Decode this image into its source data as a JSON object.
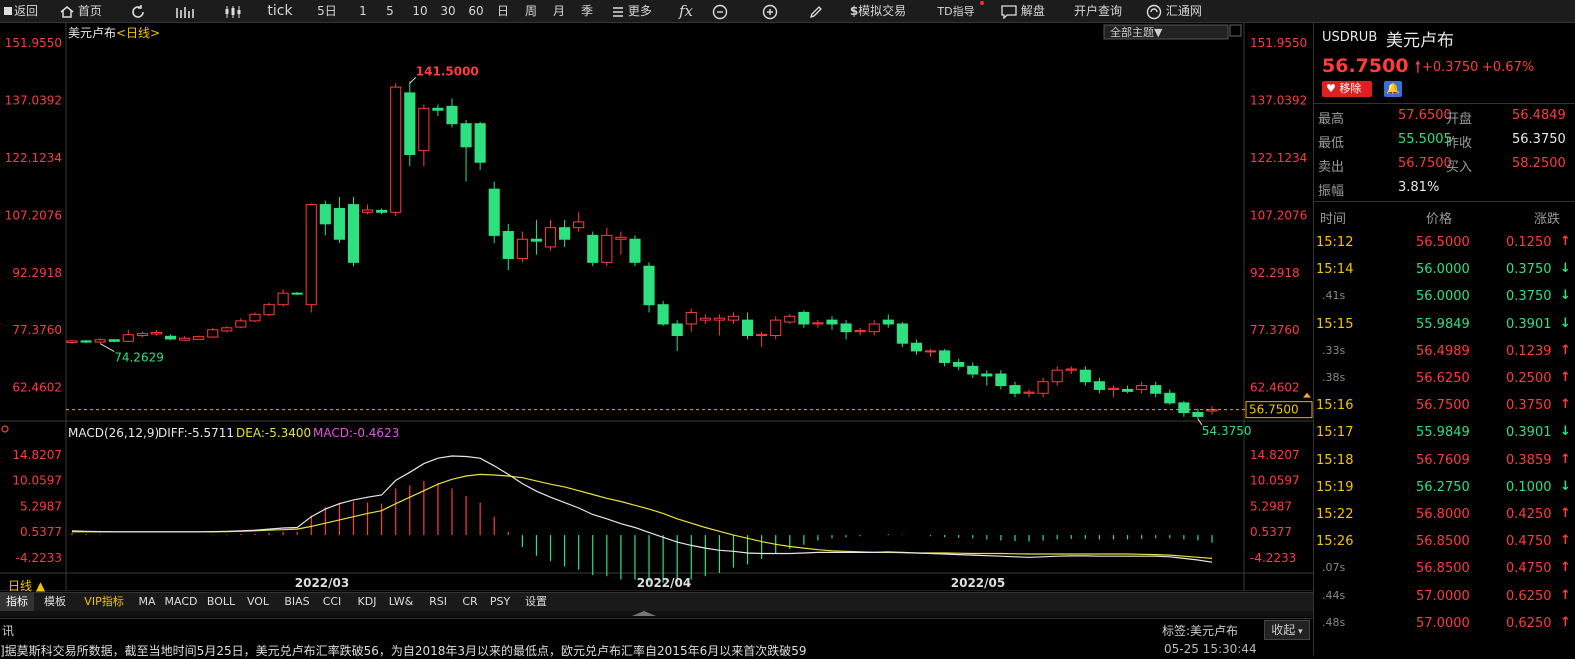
{
  "toolbar": {
    "back": "返回",
    "home": "首页",
    "tick": "tick",
    "periods": [
      "5日",
      "1",
      "5",
      "10",
      "30",
      "60",
      "日",
      "周",
      "月",
      "季"
    ],
    "more": "更多",
    "fx": "fx",
    "sim_trade": "模拟交易",
    "td_guide": "TD指导",
    "interpret": "解盘",
    "account_query": "开户查询",
    "htw": "汇通网"
  },
  "chart_header": {
    "name": "美元卢布",
    "period": "<日线>",
    "theme_button": "全部主题▼"
  },
  "chart_data": {
    "type": "candlestick",
    "price_axis_labels": [
      "151.9550",
      "137.0392",
      "122.1234",
      "107.2076",
      "92.2918",
      "77.3760",
      "62.4602"
    ],
    "price_range": [
      56.4,
      151.955
    ],
    "current_price_label": "56.7500",
    "max_label": "141.5000",
    "min_label": "54.3750",
    "start_label": "74.2629",
    "date_labels": [
      "2022/03",
      "2022/04",
      "2022/05"
    ],
    "candles": [
      [
        74.2,
        74.6,
        73.9,
        74.8
      ],
      [
        74.6,
        74.3,
        74.0,
        74.9
      ],
      [
        74.3,
        74.9,
        74.1,
        75.3
      ],
      [
        74.9,
        74.5,
        74.2,
        75.0
      ],
      [
        74.5,
        76.2,
        74.3,
        77.5
      ],
      [
        76.0,
        76.5,
        75.6,
        77.0
      ],
      [
        76.4,
        76.8,
        76.0,
        77.4
      ],
      [
        75.8,
        75.1,
        74.8,
        76.3
      ],
      [
        74.8,
        75.3,
        74.6,
        75.8
      ],
      [
        75.0,
        75.7,
        74.9,
        76.0
      ],
      [
        75.6,
        77.5,
        75.4,
        78.0
      ],
      [
        77.2,
        78.0,
        76.8,
        78.4
      ],
      [
        78.2,
        79.8,
        77.9,
        80.5
      ],
      [
        79.8,
        81.5,
        79.5,
        82.0
      ],
      [
        81.4,
        84.0,
        81.0,
        84.5
      ],
      [
        84.0,
        87.0,
        83.5,
        88.0
      ],
      [
        87.0,
        86.9,
        86.5,
        87.3
      ],
      [
        84.0,
        110.0,
        82.0,
        110.3
      ],
      [
        110.0,
        105.0,
        102.0,
        111.0
      ],
      [
        109.0,
        101.0,
        100.0,
        112.0
      ],
      [
        110.0,
        95.0,
        94.0,
        112.0
      ],
      [
        108.0,
        108.6,
        107.5,
        110.0
      ],
      [
        108.5,
        108.0,
        107.5,
        109.0
      ],
      [
        108.0,
        140.5,
        107.0,
        141.5
      ],
      [
        139.0,
        123.0,
        120.0,
        142.0
      ],
      [
        124.0,
        135.0,
        120.0,
        136.0
      ],
      [
        135.0,
        134.5,
        133.0,
        136.0
      ],
      [
        135.5,
        131.0,
        130.0,
        137.5
      ],
      [
        131.0,
        125.0,
        116.0,
        132.0
      ],
      [
        131.0,
        121.0,
        119.0,
        131.5
      ],
      [
        114.0,
        102.0,
        100.0,
        116.0
      ],
      [
        103.0,
        96.0,
        93.0,
        105.0
      ],
      [
        96.0,
        101.0,
        95.0,
        103.0
      ],
      [
        101.0,
        100.5,
        97.0,
        106.0
      ],
      [
        99.0,
        104.0,
        98.0,
        106.0
      ],
      [
        104.0,
        101.0,
        99.0,
        106.0
      ],
      [
        104.0,
        105.5,
        103.0,
        108.0
      ],
      [
        102.0,
        95.0,
        94.0,
        103.0
      ],
      [
        95.0,
        102.0,
        94.0,
        104.0
      ],
      [
        101.0,
        101.5,
        97.0,
        103.0
      ],
      [
        101.0,
        95.0,
        94.0,
        102.0
      ],
      [
        94.0,
        84.0,
        82.0,
        95.0
      ],
      [
        84.0,
        79.0,
        78.5,
        85.0
      ],
      [
        79.0,
        76.0,
        72.0,
        80.0
      ],
      [
        79.0,
        82.0,
        77.0,
        83.0
      ],
      [
        80.0,
        80.5,
        79.0,
        81.5
      ],
      [
        80.0,
        80.5,
        76.0,
        81.5
      ],
      [
        80.0,
        81.0,
        79.0,
        82.0
      ],
      [
        80.0,
        76.0,
        75.0,
        82.0
      ],
      [
        76.0,
        76.3,
        73.0,
        77.0
      ],
      [
        76.0,
        80.0,
        75.0,
        81.0
      ],
      [
        79.5,
        81.0,
        79.0,
        81.5
      ],
      [
        82.0,
        79.0,
        78.0,
        82.5
      ],
      [
        79.0,
        79.3,
        78.0,
        80.0
      ],
      [
        80.0,
        79.0,
        77.5,
        81.0
      ],
      [
        79.0,
        77.0,
        75.0,
        80.0
      ],
      [
        77.0,
        77.3,
        76.0,
        78.0
      ],
      [
        77.0,
        79.0,
        76.0,
        80.0
      ],
      [
        80.0,
        79.0,
        78.0,
        81.5
      ],
      [
        79.0,
        74.0,
        73.0,
        79.5
      ],
      [
        74.0,
        72.0,
        71.0,
        75.0
      ],
      [
        72.0,
        72.0,
        70.5,
        72.5
      ],
      [
        72.0,
        69.0,
        68.0,
        72.5
      ],
      [
        69.0,
        68.0,
        67.0,
        70.0
      ],
      [
        68.0,
        66.0,
        65.0,
        69.0
      ],
      [
        66.0,
        65.5,
        63.0,
        67.0
      ],
      [
        66.0,
        63.0,
        62.0,
        67.0
      ],
      [
        63.0,
        61.0,
        60.0,
        64.0
      ],
      [
        61.0,
        61.3,
        60.0,
        62.0
      ],
      [
        61.0,
        64.0,
        60.0,
        65.0
      ],
      [
        64.0,
        67.0,
        63.0,
        68.0
      ],
      [
        67.0,
        67.3,
        66.0,
        68.0
      ],
      [
        67.0,
        64.0,
        63.0,
        68.0
      ],
      [
        64.0,
        62.0,
        61.0,
        65.0
      ],
      [
        62.0,
        62.3,
        60.0,
        63.0
      ],
      [
        62.0,
        61.5,
        61.0,
        63.0
      ],
      [
        62.0,
        63.0,
        61.0,
        64.0
      ],
      [
        63.0,
        61.0,
        60.0,
        64.0
      ],
      [
        61.0,
        58.5,
        58.0,
        62.0
      ],
      [
        58.5,
        56.0,
        54.9,
        59.0
      ],
      [
        56.0,
        55.0,
        54.4,
        57.0
      ],
      [
        56.4,
        56.75,
        55.5,
        57.65
      ]
    ],
    "macd": {
      "label": "MACD(26,12,9)",
      "diff_label": "DIFF:-5.5711",
      "dea_label": "DEA:-5.3400",
      "macd_label": "MACD:-0.4623",
      "axis_labels": [
        "14.8207",
        "10.0597",
        "5.2987",
        "0.5377",
        "-4.2233"
      ],
      "range": [
        -7.0,
        17.0
      ],
      "diff": [
        0.8,
        0.7,
        0.65,
        0.6,
        0.6,
        0.6,
        0.6,
        0.6,
        0.6,
        0.6,
        0.65,
        0.7,
        0.8,
        0.9,
        1.1,
        1.3,
        1.4,
        3.4,
        4.8,
        5.8,
        6.5,
        7.0,
        7.4,
        10.1,
        11.6,
        13.2,
        14.2,
        14.6,
        14.5,
        14.2,
        12.8,
        11.2,
        9.5,
        8.1,
        7.0,
        6.0,
        5.0,
        3.8,
        3.0,
        2.1,
        1.4,
        0.5,
        -0.4,
        -1.3,
        -1.9,
        -2.4,
        -2.8,
        -3.0,
        -3.3,
        -3.4,
        -3.4,
        -3.4,
        -3.3,
        -3.2,
        -3.2,
        -3.2,
        -3.2,
        -3.2,
        -3.1,
        -3.2,
        -3.3,
        -3.4,
        -3.5,
        -3.6,
        -3.7,
        -3.8,
        -3.9,
        -4.0,
        -4.1,
        -4.0,
        -3.9,
        -3.85,
        -3.85,
        -3.9,
        -3.9,
        -3.9,
        -3.9,
        -3.9,
        -4.0,
        -4.3,
        -4.6,
        -5.0
      ],
      "dea": [
        0.6,
        0.6,
        0.6,
        0.6,
        0.6,
        0.6,
        0.6,
        0.6,
        0.6,
        0.6,
        0.6,
        0.65,
        0.7,
        0.8,
        0.9,
        1.0,
        1.1,
        1.6,
        2.2,
        2.8,
        3.4,
        4.0,
        4.5,
        5.8,
        7.0,
        8.2,
        9.4,
        10.3,
        10.9,
        11.2,
        11.1,
        10.9,
        10.6,
        10.0,
        9.4,
        8.9,
        8.2,
        7.5,
        6.8,
        6.2,
        5.5,
        4.8,
        4.0,
        3.0,
        2.2,
        1.4,
        0.7,
        0.0,
        -0.6,
        -1.2,
        -1.7,
        -2.1,
        -2.4,
        -2.7,
        -2.9,
        -3.0,
        -3.1,
        -3.2,
        -3.2,
        -3.25,
        -3.3,
        -3.3,
        -3.3,
        -3.35,
        -3.4,
        -3.4,
        -3.4,
        -3.45,
        -3.5,
        -3.5,
        -3.5,
        -3.5,
        -3.5,
        -3.5,
        -3.5,
        -3.5,
        -3.55,
        -3.6,
        -3.7,
        -3.9,
        -4.1,
        -4.3
      ]
    }
  },
  "period_tag": "日线 ▲",
  "tabs": [
    "指标",
    "模板",
    "VIP指标",
    "MA",
    "MACD",
    "BOLL",
    "VOL",
    "BIAS",
    "CCI",
    "KDJ",
    "LW&",
    "RSI",
    "CR",
    "PSY",
    "设置"
  ],
  "news": {
    "left_label": "讯",
    "tag": "标签:美元卢布",
    "collapse": "收起",
    "ticker": "]据莫斯科交易所数据，截至当地时间5月25日，美元兑卢布汇率跌破56，为自2018年3月以来的最低点，欧元兑卢布汇率自2015年6月以来首次跌破59",
    "time": "05-25 15:30:44"
  },
  "quote": {
    "code": "USDRUB",
    "name": "美元卢布",
    "price": "56.7500",
    "change": "+0.3750",
    "change_pct": "+0.67%",
    "remove_btn": "移除",
    "stats": [
      {
        "label": "最高",
        "value": "57.6500",
        "label2": "开盘",
        "value2": "56.4849"
      },
      {
        "label": "最低",
        "value": "55.5005",
        "label2": "昨收",
        "value2": "56.3750"
      },
      {
        "label": "卖出",
        "value": "56.7500",
        "label2": "买入",
        "value2": "58.2500"
      }
    ],
    "amplitude_label": "振幅",
    "amplitude": "3.81%",
    "headers": [
      "时间",
      "价格",
      "涨跌"
    ],
    "ticks": [
      {
        "time": "15:12",
        "price": "56.5000",
        "change": "0.1250",
        "dir": "up"
      },
      {
        "time": "15:14",
        "price": "56.0000",
        "change": "0.3750",
        "dir": "down"
      },
      {
        "time": ".41s",
        "price": "56.0000",
        "change": "0.3750",
        "dir": "down"
      },
      {
        "time": "15:15",
        "price": "55.9849",
        "change": "0.3901",
        "dir": "down"
      },
      {
        "time": ".33s",
        "price": "56.4989",
        "change": "0.1239",
        "dir": "up"
      },
      {
        "time": ".38s",
        "price": "56.6250",
        "change": "0.2500",
        "dir": "up"
      },
      {
        "time": "15:16",
        "price": "56.7500",
        "change": "0.3750",
        "dir": "up"
      },
      {
        "time": "15:17",
        "price": "55.9849",
        "change": "0.3901",
        "dir": "down"
      },
      {
        "time": "15:18",
        "price": "56.7609",
        "change": "0.3859",
        "dir": "up"
      },
      {
        "time": "15:19",
        "price": "56.2750",
        "change": "0.1000",
        "dir": "down"
      },
      {
        "time": "15:22",
        "price": "56.8000",
        "change": "0.4250",
        "dir": "up"
      },
      {
        "time": "15:26",
        "price": "56.8500",
        "change": "0.4750",
        "dir": "up"
      },
      {
        "time": ".07s",
        "price": "56.8500",
        "change": "0.4750",
        "dir": "up"
      },
      {
        "time": ".44s",
        "price": "57.0000",
        "change": "0.6250",
        "dir": "up"
      },
      {
        "time": ".48s",
        "price": "57.0000",
        "change": "0.6250",
        "dir": "up"
      }
    ]
  },
  "colors": {
    "up": "#ff3b3b",
    "down": "#2ee07f",
    "diff": "#e6e6e6",
    "dea": "#e8e23a",
    "accent": "#f5c400"
  }
}
